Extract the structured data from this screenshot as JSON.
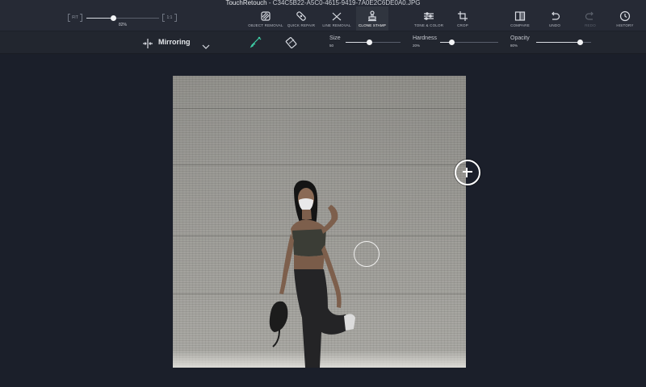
{
  "titlebar": {
    "app": "TouchRetouch",
    "separator": " - ",
    "filename": "C34C5B22-A5C0-4615-9419-7A0E2C6DE0A0.JPG"
  },
  "zoom": {
    "fit_label": "FIT",
    "one_to_one_label": "1:1",
    "value_text": "82%",
    "value_fraction": 0.37
  },
  "tools": {
    "object_removal": "OBJECT REMOVAL",
    "quick_repair": "QUICK REPAIR",
    "line_removal": "LINE REMOVAL",
    "clone_stamp": "CLONE STAMP",
    "tone_color": "TONE & COLOR",
    "crop": "CROP",
    "compare": "COMPARE",
    "undo": "UNDO",
    "redo": "REDO",
    "history": "HISTORY"
  },
  "icons": {
    "object_removal": "object-removal-icon",
    "quick_repair": "bandage-icon",
    "line_removal": "line-removal-icon",
    "clone_stamp": "stamp-icon",
    "tone_color": "sliders-icon",
    "crop": "crop-icon",
    "compare": "compare-icon",
    "undo": "undo-icon",
    "redo": "redo-icon",
    "history": "history-clock-icon",
    "mirroring": "mirror-arrows-icon",
    "brush": "brush-icon",
    "eraser": "eraser-icon"
  },
  "options": {
    "mode_label": "Mirroring",
    "size": {
      "label": "Size",
      "value": "50",
      "fraction": 0.42
    },
    "hardness": {
      "label": "Hardness",
      "value": "20%",
      "fraction": 0.2
    },
    "opacity": {
      "label": "Opacity",
      "value": "80%",
      "fraction": 0.8
    }
  },
  "colors": {
    "background": "#1b1f2a",
    "toolbar": "#262a35",
    "brush_accent": "#3fd1a8"
  }
}
